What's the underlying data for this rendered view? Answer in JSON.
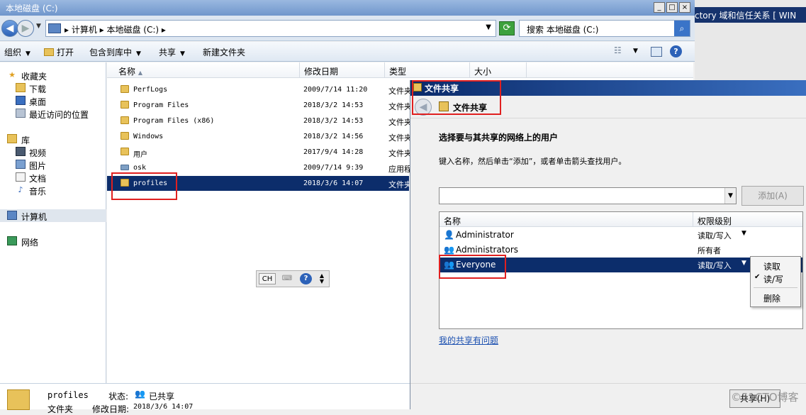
{
  "explorer": {
    "title": "本地磁盘 (C:)",
    "win_buttons": [
      "_",
      "□",
      "×"
    ],
    "path": "▸ 计算机 ▸ 本地磁盘 (C:) ▸",
    "search_placeholder": "搜索 本地磁盘 (C:)",
    "toolbar": {
      "organize": "组织",
      "open": "打开",
      "include_in_library": "包含到库中",
      "share": "共享",
      "new_folder": "新建文件夹"
    },
    "nav": {
      "favorites": "收藏夹",
      "downloads": "下载",
      "desktop": "桌面",
      "recent": "最近访问的位置",
      "libraries": "库",
      "videos": "视频",
      "pictures": "图片",
      "documents": "文档",
      "music": "音乐",
      "computer": "计算机",
      "network": "网络"
    },
    "columns": {
      "name": "名称",
      "date": "修改日期",
      "type": "类型",
      "size": "大小"
    },
    "files": [
      {
        "name": "PerfLogs",
        "date": "2009/7/14 11:20",
        "type": "文件夹"
      },
      {
        "name": "Program Files",
        "date": "2018/3/2 14:53",
        "type": "文件夹"
      },
      {
        "name": "Program Files (x86)",
        "date": "2018/3/2 14:53",
        "type": "文件夹"
      },
      {
        "name": "Windows",
        "date": "2018/3/2 14:56",
        "type": "文件夹"
      },
      {
        "name": "用户",
        "date": "2017/9/4 14:28",
        "type": "文件夹"
      },
      {
        "name": "osk",
        "date": "2009/7/14 9:39",
        "type": "应用程序"
      },
      {
        "name": "profiles",
        "date": "2018/3/6 14:07",
        "type": "文件夹"
      }
    ],
    "ime": {
      "lang": "CH"
    },
    "status": {
      "name": "profiles",
      "state_label": "状态:",
      "state_value": "已共享",
      "type": "文件夹",
      "modified_label": "修改日期:",
      "modified_value": "2018/3/6 14:07"
    }
  },
  "background_window": {
    "title": "ctory 域和信任关系 [ WIN"
  },
  "share_dialog": {
    "title": "文件共享",
    "nav_title": "文件共享",
    "heading": "选择要与其共享的网络上的用户",
    "instruction": "键入名称，然后单击“添加”，或者单击箭头查找用户。",
    "add_button": "添加(A)",
    "col_name": "名称",
    "col_permission": "权限级别",
    "users": [
      {
        "name": "Administrator",
        "permission": "读取/写入",
        "has_arrow": true
      },
      {
        "name": "Administrators",
        "permission": "所有者",
        "has_arrow": false
      },
      {
        "name": "Everyone",
        "permission": "读取/写入",
        "has_arrow": true
      }
    ],
    "menu": {
      "read": "读取",
      "read_write": "读/写",
      "remove": "删除",
      "checked": "✔"
    },
    "help_link": "我的共享有问题",
    "share_button": "共享(H)",
    "watermark": "©51CTO博客"
  }
}
